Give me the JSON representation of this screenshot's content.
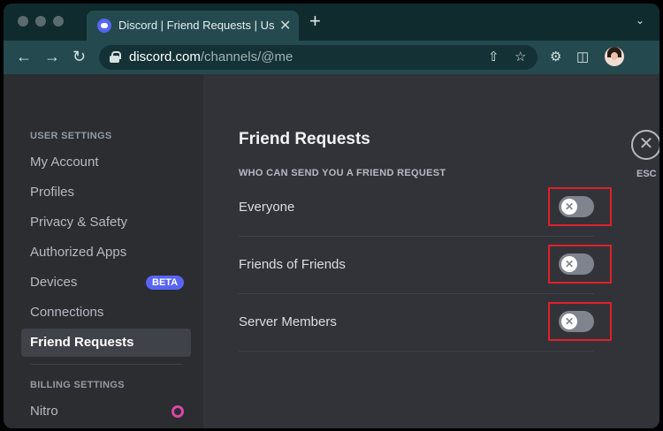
{
  "browser": {
    "tab_title": "Discord | Friend Requests | User Settings",
    "tab_close": "✕",
    "new_tab": "+",
    "url_host": "discord.com",
    "url_path": "/channels/@me",
    "icons": [
      "back-icon",
      "forward-icon",
      "reload-icon",
      "share-icon",
      "bookmark-star-icon",
      "extensions-icon",
      "side-panel-icon",
      "profile-avatar"
    ]
  },
  "sidebar": {
    "user_settings_header": "USER SETTINGS",
    "items": [
      {
        "label": "My Account"
      },
      {
        "label": "Profiles"
      },
      {
        "label": "Privacy & Safety"
      },
      {
        "label": "Authorized Apps"
      },
      {
        "label": "Devices",
        "badge": "BETA"
      },
      {
        "label": "Connections"
      },
      {
        "label": "Friend Requests",
        "active": true
      }
    ],
    "billing_header": "BILLING SETTINGS",
    "billing_items": [
      {
        "label": "Nitro"
      }
    ]
  },
  "main": {
    "title": "Friend Requests",
    "subheader": "WHO CAN SEND YOU A FRIEND REQUEST",
    "options": [
      {
        "label": "Everyone",
        "enabled": false
      },
      {
        "label": "Friends of Friends",
        "enabled": false
      },
      {
        "label": "Server Members",
        "enabled": false
      }
    ],
    "close_label": "ESC"
  },
  "colors": {
    "accent": "#5865f2",
    "highlight_box": "#e0202a",
    "toggle_off": "#80848e"
  }
}
